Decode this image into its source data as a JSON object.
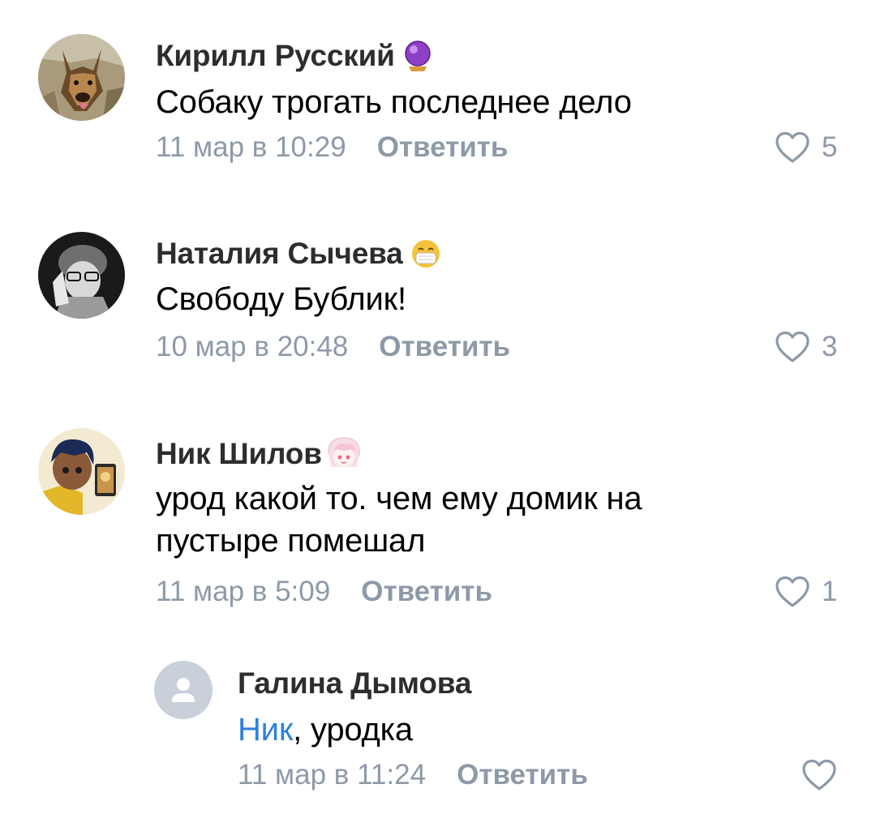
{
  "comments": [
    {
      "author": "Кирилл Русский",
      "badge_icon": "crystal-ball-icon",
      "text": "Собаку трогать последнее дело",
      "date": "11 мар в 10:29",
      "reply_label": "Ответить",
      "likes": "5"
    },
    {
      "author": "Наталия Сычева",
      "badge_icon": "mask-face-icon",
      "text": "Свободу Бублик!",
      "date": "10 мар в 20:48",
      "reply_label": "Ответить",
      "likes": "3"
    },
    {
      "author": "Ник Шилов",
      "badge_icon": "anime-girl-sticker-icon",
      "text": "урод какой то. чем ему домик на пустыре помешал",
      "date": "11 мар в 5:09",
      "reply_label": "Ответить",
      "likes": "1"
    }
  ],
  "reply": {
    "author": "Галина Дымова",
    "mention": "Ник",
    "text": ", уродка",
    "date": "11 мар в 11:24",
    "reply_label": "Ответить",
    "likes": ""
  },
  "colors": {
    "meta": "#8e99a8",
    "author": "#2c2d2e",
    "mention": "#2d81e0",
    "placeholder_avatar": "#c9d0da"
  }
}
